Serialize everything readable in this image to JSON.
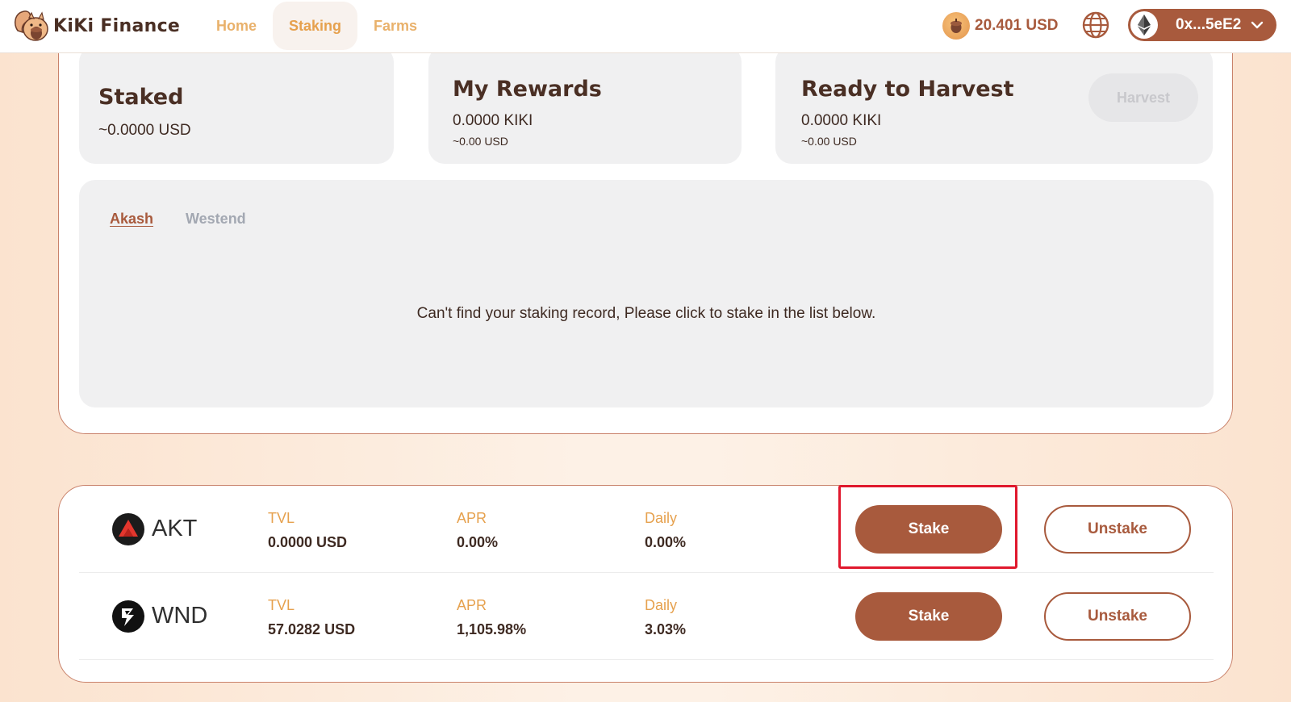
{
  "header": {
    "logo_text": "KiKi Finance",
    "nav": [
      {
        "label": "Home",
        "active": false
      },
      {
        "label": "Staking",
        "active": true
      },
      {
        "label": "Farms",
        "active": false
      }
    ],
    "balance": "20.401 USD",
    "wallet_address": "0x...5eE2"
  },
  "summary": {
    "staked": {
      "title": "Staked",
      "amount": "~0.0000 USD"
    },
    "rewards": {
      "title": "My Rewards",
      "amount": "0.0000 KIKI",
      "usd": "~0.00 USD"
    },
    "harvest": {
      "title": "Ready to Harvest",
      "amount": "0.0000 KIKI",
      "usd": "~0.00 USD",
      "button_label": "Harvest"
    }
  },
  "records": {
    "tabs": [
      {
        "label": "Akash",
        "active": true
      },
      {
        "label": "Westend",
        "active": false
      }
    ],
    "empty_message": "Can't find your staking record, Please click to stake in the list below."
  },
  "pools": [
    {
      "token": "AKT",
      "icon": "akash-token-icon",
      "tvl_label": "TVL",
      "tvl": "0.0000 USD",
      "apr_label": "APR",
      "apr": "0.00%",
      "daily_label": "Daily",
      "daily": "0.00%",
      "stake_label": "Stake",
      "unstake_label": "Unstake"
    },
    {
      "token": "WND",
      "icon": "westend-token-icon",
      "tvl_label": "TVL",
      "tvl": "57.0282 USD",
      "apr_label": "APR",
      "apr": "1,105.98%",
      "daily_label": "Daily",
      "daily": "3.03%",
      "stake_label": "Stake",
      "unstake_label": "Unstake"
    }
  ],
  "colors": {
    "brand_brown": "#a85a3d",
    "accent_orange": "#e6a14e",
    "highlight_red": "#e0182d"
  }
}
